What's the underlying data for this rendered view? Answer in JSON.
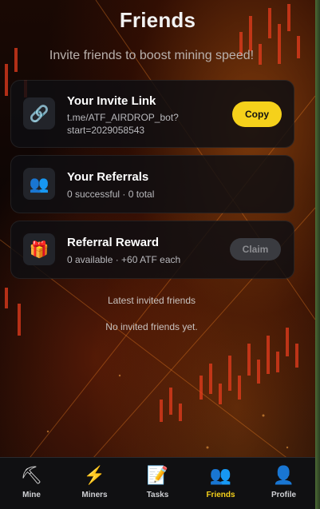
{
  "header": {
    "title": "Friends",
    "subtitle": "Invite friends to boost mining speed!"
  },
  "cards": {
    "invite": {
      "icon": "link-icon",
      "title": "Your Invite Link",
      "link_line1": "t.me/ATF_AIRDROP_bot?",
      "link_line2": "start=2029058543",
      "button": "Copy"
    },
    "referrals": {
      "icon": "people-icon",
      "title": "Your Referrals",
      "text": "0 successful · 0 total"
    },
    "reward": {
      "icon": "gift-icon",
      "title": "Referral Reward",
      "text": "0 available · +60 ATF each",
      "button": "Claim"
    }
  },
  "latest": {
    "heading": "Latest invited friends",
    "empty": "No invited friends yet."
  },
  "nav": {
    "items": [
      {
        "label": "Mine",
        "icon": "pickaxe-icon"
      },
      {
        "label": "Miners",
        "icon": "lightning-icon"
      },
      {
        "label": "Tasks",
        "icon": "memo-icon"
      },
      {
        "label": "Friends",
        "icon": "people-icon",
        "active": true
      },
      {
        "label": "Profile",
        "icon": "user-icon"
      }
    ]
  },
  "colors": {
    "accent": "#f5d11b",
    "card_bg": "#0e0e12",
    "nav_bg": "#101012"
  }
}
